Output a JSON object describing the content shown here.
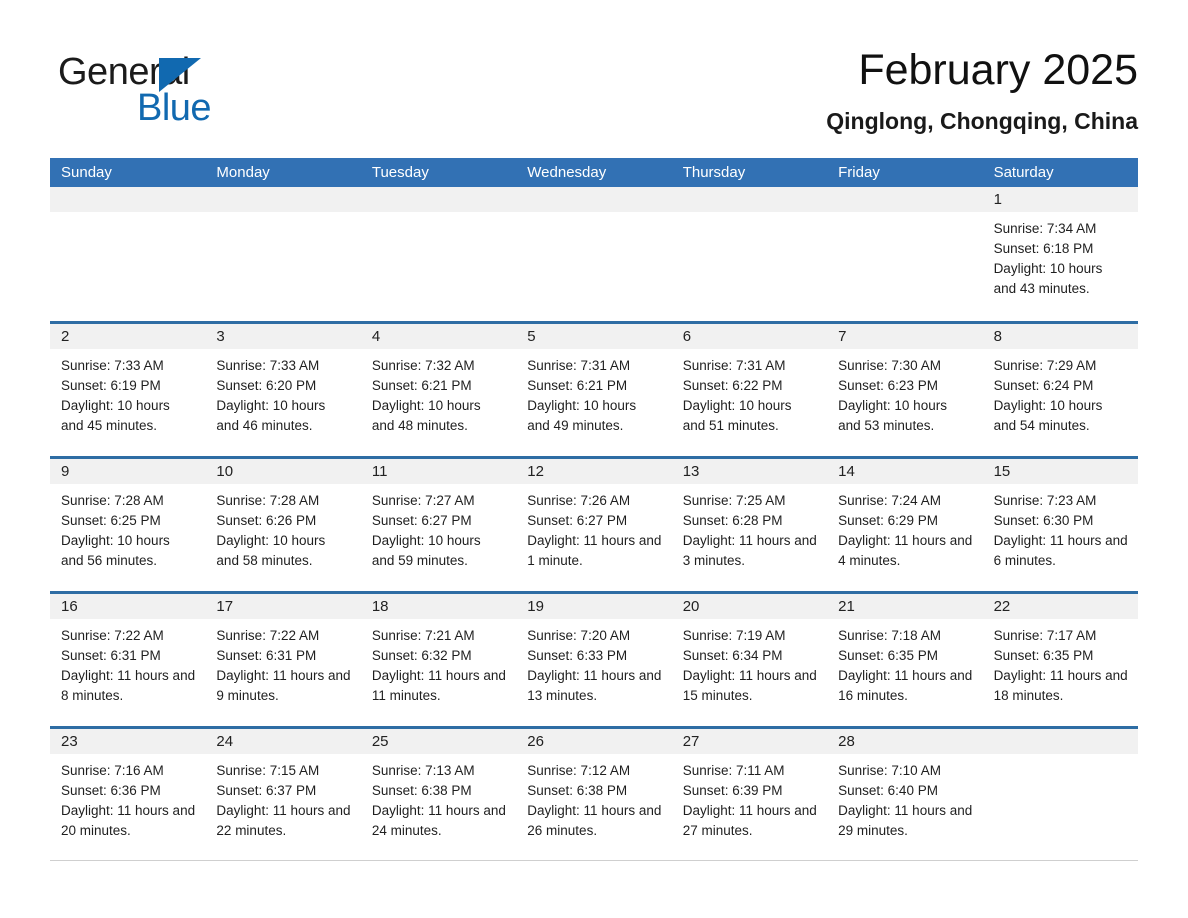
{
  "brand": {
    "name_part1": "General",
    "name_part2": "Blue",
    "logo_icon": "triangle-icon",
    "accent_color": "#1169b0"
  },
  "header": {
    "title": "February 2025",
    "subtitle": "Qinglong, Chongqing, China"
  },
  "colors": {
    "header_blue": "#3271b4",
    "row_divider_blue": "#2e6da4",
    "date_band_gray": "#f1f1f1"
  },
  "weekdays": [
    "Sunday",
    "Monday",
    "Tuesday",
    "Wednesday",
    "Thursday",
    "Friday",
    "Saturday"
  ],
  "labels": {
    "sunrise": "Sunrise:",
    "sunset": "Sunset:",
    "daylight": "Daylight:"
  },
  "weeks": [
    [
      {
        "date": "",
        "empty": true
      },
      {
        "date": "",
        "empty": true
      },
      {
        "date": "",
        "empty": true
      },
      {
        "date": "",
        "empty": true
      },
      {
        "date": "",
        "empty": true
      },
      {
        "date": "",
        "empty": true
      },
      {
        "date": "1",
        "sunrise": "Sunrise: 7:34 AM",
        "sunset": "Sunset: 6:18 PM",
        "daylight": "Daylight: 10 hours and 43 minutes."
      }
    ],
    [
      {
        "date": "2",
        "sunrise": "Sunrise: 7:33 AM",
        "sunset": "Sunset: 6:19 PM",
        "daylight": "Daylight: 10 hours and 45 minutes."
      },
      {
        "date": "3",
        "sunrise": "Sunrise: 7:33 AM",
        "sunset": "Sunset: 6:20 PM",
        "daylight": "Daylight: 10 hours and 46 minutes."
      },
      {
        "date": "4",
        "sunrise": "Sunrise: 7:32 AM",
        "sunset": "Sunset: 6:21 PM",
        "daylight": "Daylight: 10 hours and 48 minutes."
      },
      {
        "date": "5",
        "sunrise": "Sunrise: 7:31 AM",
        "sunset": "Sunset: 6:21 PM",
        "daylight": "Daylight: 10 hours and 49 minutes."
      },
      {
        "date": "6",
        "sunrise": "Sunrise: 7:31 AM",
        "sunset": "Sunset: 6:22 PM",
        "daylight": "Daylight: 10 hours and 51 minutes."
      },
      {
        "date": "7",
        "sunrise": "Sunrise: 7:30 AM",
        "sunset": "Sunset: 6:23 PM",
        "daylight": "Daylight: 10 hours and 53 minutes."
      },
      {
        "date": "8",
        "sunrise": "Sunrise: 7:29 AM",
        "sunset": "Sunset: 6:24 PM",
        "daylight": "Daylight: 10 hours and 54 minutes."
      }
    ],
    [
      {
        "date": "9",
        "sunrise": "Sunrise: 7:28 AM",
        "sunset": "Sunset: 6:25 PM",
        "daylight": "Daylight: 10 hours and 56 minutes."
      },
      {
        "date": "10",
        "sunrise": "Sunrise: 7:28 AM",
        "sunset": "Sunset: 6:26 PM",
        "daylight": "Daylight: 10 hours and 58 minutes."
      },
      {
        "date": "11",
        "sunrise": "Sunrise: 7:27 AM",
        "sunset": "Sunset: 6:27 PM",
        "daylight": "Daylight: 10 hours and 59 minutes."
      },
      {
        "date": "12",
        "sunrise": "Sunrise: 7:26 AM",
        "sunset": "Sunset: 6:27 PM",
        "daylight": "Daylight: 11 hours and 1 minute."
      },
      {
        "date": "13",
        "sunrise": "Sunrise: 7:25 AM",
        "sunset": "Sunset: 6:28 PM",
        "daylight": "Daylight: 11 hours and 3 minutes."
      },
      {
        "date": "14",
        "sunrise": "Sunrise: 7:24 AM",
        "sunset": "Sunset: 6:29 PM",
        "daylight": "Daylight: 11 hours and 4 minutes."
      },
      {
        "date": "15",
        "sunrise": "Sunrise: 7:23 AM",
        "sunset": "Sunset: 6:30 PM",
        "daylight": "Daylight: 11 hours and 6 minutes."
      }
    ],
    [
      {
        "date": "16",
        "sunrise": "Sunrise: 7:22 AM",
        "sunset": "Sunset: 6:31 PM",
        "daylight": "Daylight: 11 hours and 8 minutes."
      },
      {
        "date": "17",
        "sunrise": "Sunrise: 7:22 AM",
        "sunset": "Sunset: 6:31 PM",
        "daylight": "Daylight: 11 hours and 9 minutes."
      },
      {
        "date": "18",
        "sunrise": "Sunrise: 7:21 AM",
        "sunset": "Sunset: 6:32 PM",
        "daylight": "Daylight: 11 hours and 11 minutes."
      },
      {
        "date": "19",
        "sunrise": "Sunrise: 7:20 AM",
        "sunset": "Sunset: 6:33 PM",
        "daylight": "Daylight: 11 hours and 13 minutes."
      },
      {
        "date": "20",
        "sunrise": "Sunrise: 7:19 AM",
        "sunset": "Sunset: 6:34 PM",
        "daylight": "Daylight: 11 hours and 15 minutes."
      },
      {
        "date": "21",
        "sunrise": "Sunrise: 7:18 AM",
        "sunset": "Sunset: 6:35 PM",
        "daylight": "Daylight: 11 hours and 16 minutes."
      },
      {
        "date": "22",
        "sunrise": "Sunrise: 7:17 AM",
        "sunset": "Sunset: 6:35 PM",
        "daylight": "Daylight: 11 hours and 18 minutes."
      }
    ],
    [
      {
        "date": "23",
        "sunrise": "Sunrise: 7:16 AM",
        "sunset": "Sunset: 6:36 PM",
        "daylight": "Daylight: 11 hours and 20 minutes."
      },
      {
        "date": "24",
        "sunrise": "Sunrise: 7:15 AM",
        "sunset": "Sunset: 6:37 PM",
        "daylight": "Daylight: 11 hours and 22 minutes."
      },
      {
        "date": "25",
        "sunrise": "Sunrise: 7:13 AM",
        "sunset": "Sunset: 6:38 PM",
        "daylight": "Daylight: 11 hours and 24 minutes."
      },
      {
        "date": "26",
        "sunrise": "Sunrise: 7:12 AM",
        "sunset": "Sunset: 6:38 PM",
        "daylight": "Daylight: 11 hours and 26 minutes."
      },
      {
        "date": "27",
        "sunrise": "Sunrise: 7:11 AM",
        "sunset": "Sunset: 6:39 PM",
        "daylight": "Daylight: 11 hours and 27 minutes."
      },
      {
        "date": "28",
        "sunrise": "Sunrise: 7:10 AM",
        "sunset": "Sunset: 6:40 PM",
        "daylight": "Daylight: 11 hours and 29 minutes."
      },
      {
        "date": "",
        "empty": true
      }
    ]
  ]
}
